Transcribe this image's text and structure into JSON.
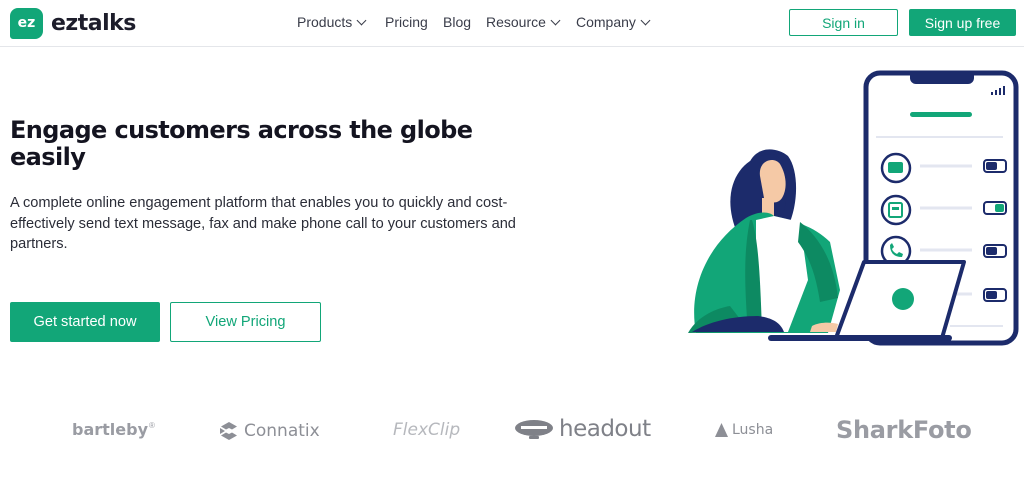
{
  "nav": {
    "logo_badge": "ez",
    "logo_text": "eztalks",
    "items": [
      {
        "label": "Products",
        "has_dropdown": true
      },
      {
        "label": "Pricing",
        "has_dropdown": false
      },
      {
        "label": "Blog",
        "has_dropdown": false
      },
      {
        "label": "Resource",
        "has_dropdown": true
      },
      {
        "label": "Company",
        "has_dropdown": true
      }
    ],
    "signin_label": "Sign in",
    "signup_label": "Sign up free"
  },
  "hero": {
    "title": "Engage customers across the globe easily",
    "description": "A complete online engagement platform that enables you to quickly and cost-effectively send text message, fax and make phone call to your customers and partners.",
    "primary_cta": "Get started now",
    "secondary_cta": "View Pricing"
  },
  "partners": [
    {
      "name": "bartleby",
      "mark": "®"
    },
    {
      "name": "Connatix"
    },
    {
      "name": "FlexClip"
    },
    {
      "name": "headout"
    },
    {
      "name": "Lusha"
    },
    {
      "name": "SharkFoto"
    }
  ],
  "colors": {
    "accent": "#12a678",
    "navy": "#1c2b6b",
    "text": "#1d1d2b"
  }
}
